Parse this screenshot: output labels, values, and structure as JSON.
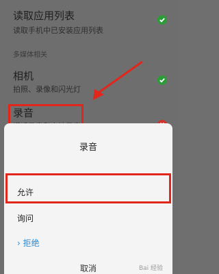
{
  "permissions": [
    {
      "title": "读取应用列表",
      "subtitle": "读取手机中已安装应用列表",
      "status": "allowed"
    },
    {
      "title": "相机",
      "subtitle": "拍照、录像和闪光灯",
      "status": "allowed"
    },
    {
      "title": "录音",
      "subtitle": "通话录音和本地录音",
      "status": "denied"
    }
  ],
  "section_label": "多媒体相关",
  "dialog": {
    "title": "录音",
    "options": [
      {
        "label": "允许",
        "selected": false
      },
      {
        "label": "询问",
        "selected": false
      },
      {
        "label": "拒绝",
        "selected": true
      }
    ],
    "selected_marker": "›",
    "cancel_label": "取消"
  },
  "watermark": "Bai 经验",
  "colors": {
    "allowed": "#2e9b3a",
    "denied": "#d0342c",
    "highlight": "#e2261c",
    "selected_option": "#2a8ad4"
  }
}
